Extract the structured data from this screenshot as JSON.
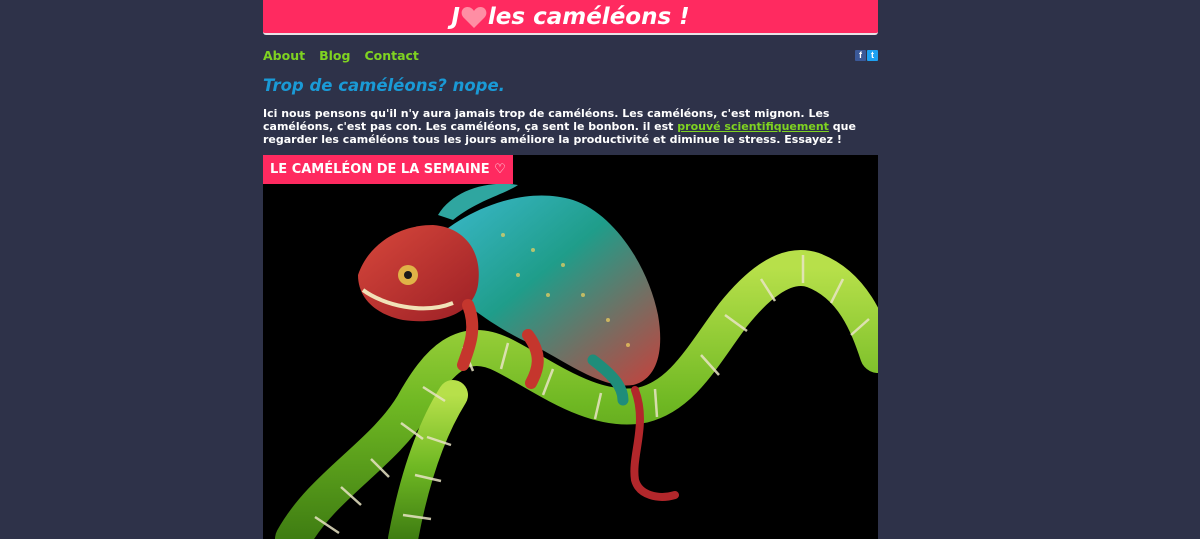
{
  "header": {
    "title_prefix": "J",
    "title_suffix": "les caméléons !",
    "heart_icon": "heart-icon",
    "accent_color": "#ff2a60"
  },
  "nav": {
    "items": [
      {
        "label": "About"
      },
      {
        "label": "Blog"
      },
      {
        "label": "Contact"
      }
    ],
    "link_color": "#7fd321"
  },
  "social": {
    "facebook_glyph": "f",
    "twitter_glyph": "t",
    "icons": [
      "facebook-icon",
      "twitter-icon"
    ]
  },
  "main": {
    "subtitle": "Trop de caméléons? nope.",
    "intro_before_link": "Ici nous pensons qu'il n'y aura jamais trop de caméléons. Les caméléons, c'est mignon. Les caméléons, c'est pas con. Les caméléons, ça sent le bonbon. il est ",
    "intro_link": "prouvé scientifiquement",
    "intro_after_link": " que regarder les caméléons tous les jours améliore la productivité et diminue le stress. Essayez !",
    "feature_label": "LE CAMÉLÉON DE LA SEMAINE ♡"
  },
  "colors": {
    "background": "#2e3249",
    "subtitle": "#1a9ad6",
    "text": "#ffffff"
  }
}
